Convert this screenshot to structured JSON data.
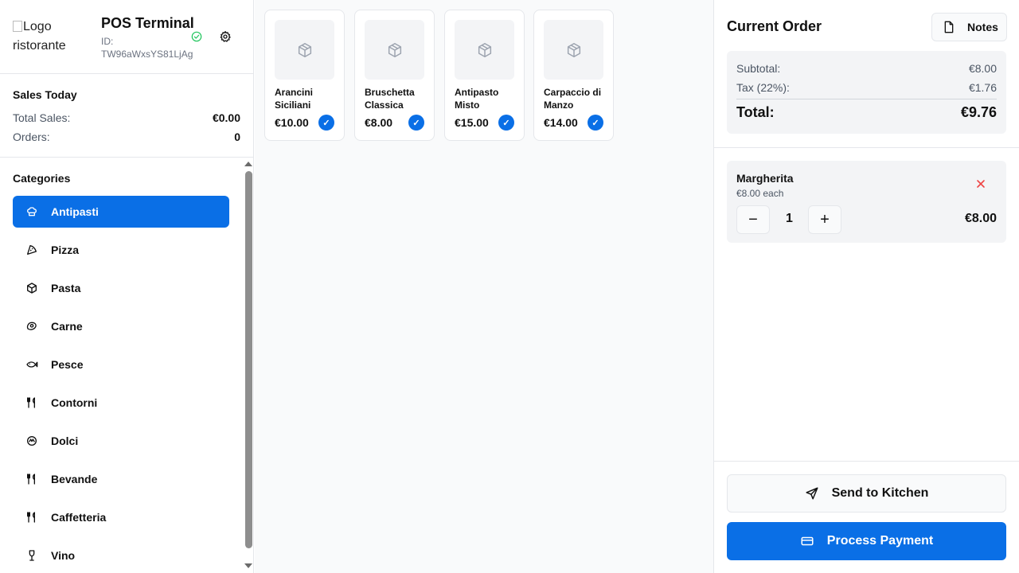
{
  "header": {
    "logo_alt": "Logo ristorante",
    "title": "POS Terminal",
    "id_label": "ID:",
    "id_value": "TW96aWxsYS81LjAg"
  },
  "sales": {
    "title": "Sales Today",
    "total_label": "Total Sales:",
    "total_value": "€0.00",
    "orders_label": "Orders:",
    "orders_value": "0"
  },
  "categories": {
    "title": "Categories",
    "items": [
      {
        "label": "Antipasti",
        "icon": "chef-hat-icon",
        "active": true
      },
      {
        "label": "Pizza",
        "icon": "pizza-icon"
      },
      {
        "label": "Pasta",
        "icon": "box-icon"
      },
      {
        "label": "Carne",
        "icon": "beef-icon"
      },
      {
        "label": "Pesce",
        "icon": "fish-icon"
      },
      {
        "label": "Contorni",
        "icon": "utensils-icon"
      },
      {
        "label": "Dolci",
        "icon": "cake-icon"
      },
      {
        "label": "Bevande",
        "icon": "utensils-icon"
      },
      {
        "label": "Caffetteria",
        "icon": "utensils-icon"
      },
      {
        "label": "Vino",
        "icon": "wine-icon"
      }
    ]
  },
  "products": [
    {
      "name": "Arancini Siciliani",
      "price": "€10.00",
      "check": "✓"
    },
    {
      "name": "Bruschetta Classica",
      "price": "€8.00",
      "check": "✓"
    },
    {
      "name": "Antipasto Misto",
      "price": "€15.00",
      "check": "✓"
    },
    {
      "name": "Carpaccio di Manzo",
      "price": "€14.00",
      "check": "✓"
    }
  ],
  "order": {
    "title": "Current Order",
    "notes_label": "Notes",
    "subtotal_label": "Subtotal:",
    "subtotal_value": "€8.00",
    "tax_label": "Tax (22%):",
    "tax_value": "€1.76",
    "total_label": "Total:",
    "total_value": "€9.76",
    "items": [
      {
        "name": "Margherita",
        "each": "€8.00 each",
        "qty": "1",
        "total": "€8.00",
        "minus": "−",
        "plus": "+"
      }
    ],
    "send_label": "Send to Kitchen",
    "pay_label": "Process Payment"
  },
  "colors": {
    "accent": "#0a6fe6",
    "success": "#22c55e",
    "danger": "#ef4444"
  }
}
